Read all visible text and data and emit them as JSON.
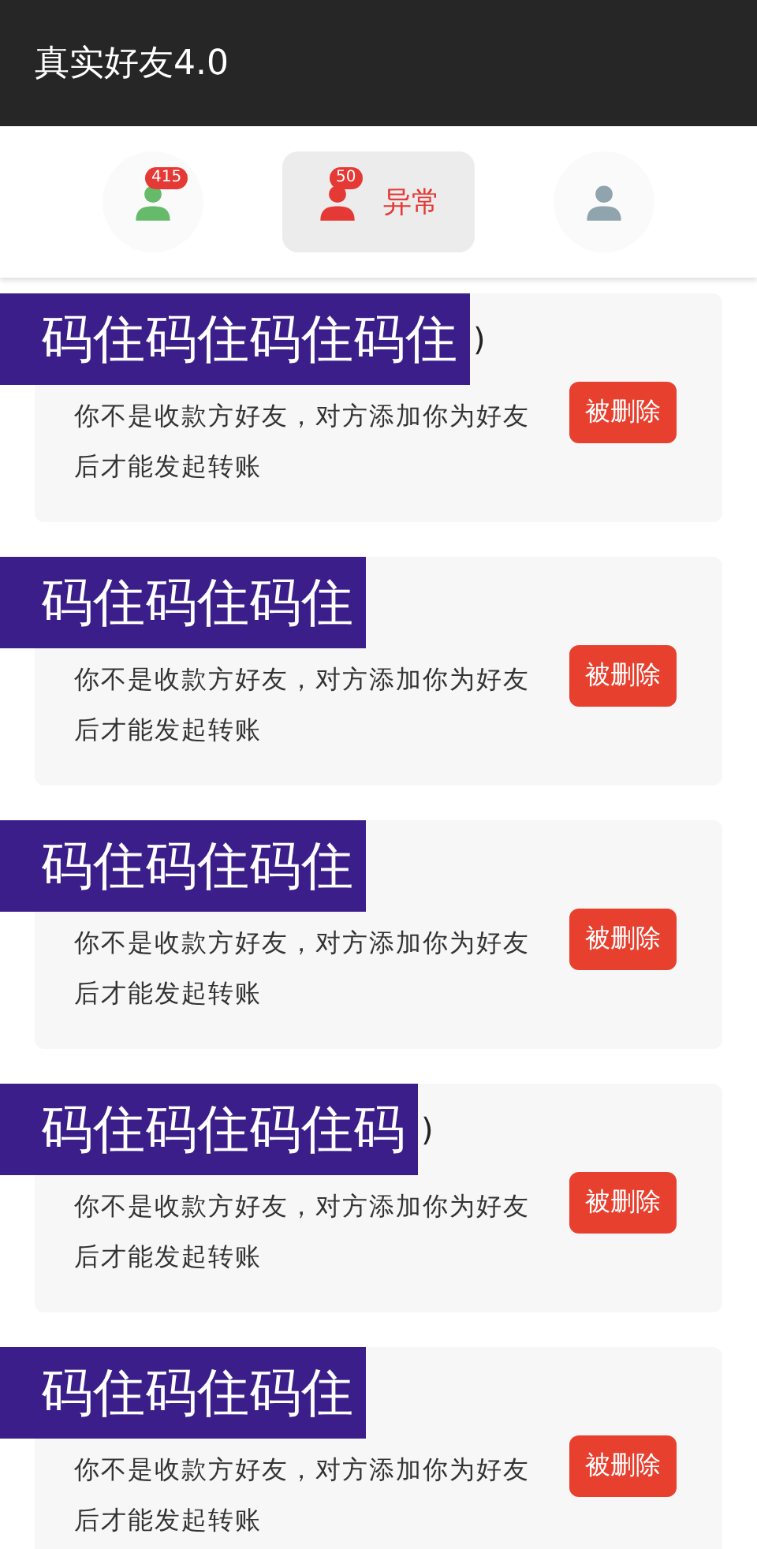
{
  "app_bar": {
    "title": "真实好友4.0"
  },
  "tabs": [
    {
      "kind": "normal",
      "badge": "415",
      "selected": false
    },
    {
      "kind": "abnormal",
      "badge": "50",
      "label": "异常",
      "selected": true
    },
    {
      "kind": "profile",
      "selected": false
    }
  ],
  "friends": [
    {
      "redaction": "码住码住码住码住",
      "name_tail": ")",
      "message": "你不是收款方好友，对方添加你为好友后才能发起转账",
      "status_button": "被删除"
    },
    {
      "redaction": "码住码住码住",
      "message": "你不是收款方好友，对方添加你为好友后才能发起转账",
      "status_button": "被删除"
    },
    {
      "redaction": "码住码住码住",
      "message": "你不是收款方好友，对方添加你为好友后才能发起转账",
      "status_button": "被删除"
    },
    {
      "redaction": "码住码住码住码",
      "name_tail": ")",
      "message": "你不是收款方好友，对方添加你为好友后才能发起转账",
      "status_button": "被删除"
    },
    {
      "redaction": "码住码住码住",
      "message": "你不是收款方好友，对方添加你为好友后才能发起转账",
      "status_button": "被删除"
    }
  ]
}
